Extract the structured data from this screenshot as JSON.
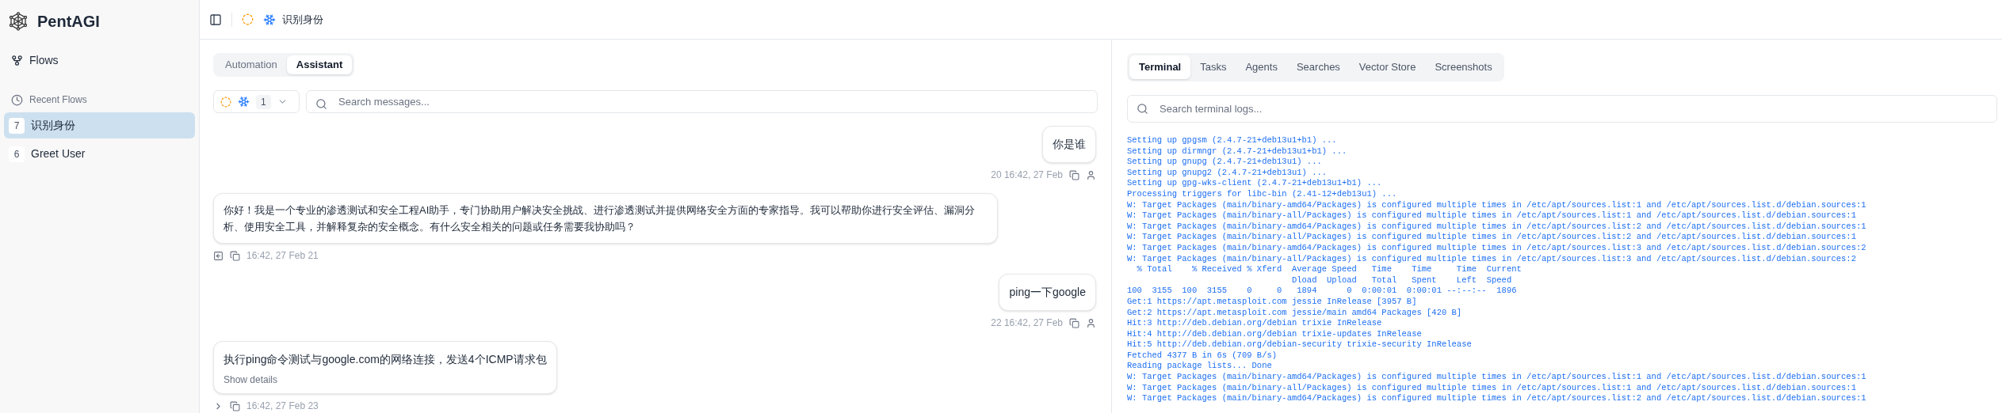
{
  "sidebar": {
    "brand": "PentAGI",
    "nav": [
      {
        "label": "Flows"
      }
    ],
    "section_title": "Recent Flows",
    "flows": [
      {
        "number": "7",
        "title": "识别身份",
        "selected": true
      },
      {
        "number": "6",
        "title": "Greet User",
        "selected": false
      }
    ]
  },
  "header": {
    "flow_title": "识别身份"
  },
  "chat": {
    "tabs": [
      {
        "label": "Automation",
        "selected": false
      },
      {
        "label": "Assistant",
        "selected": true
      }
    ],
    "filter": {
      "count": "1"
    },
    "search": {
      "placeholder": "Search messages..."
    },
    "messages": [
      {
        "kind": "user",
        "text": "你是谁",
        "meta": "20 16:42, 27 Feb"
      },
      {
        "kind": "assistant",
        "text": "你好！我是一个专业的渗透测试和安全工程AI助手，专门协助用户解决安全挑战、进行渗透测试并提供网络安全方面的专家指导。我可以帮助你进行安全评估、漏洞分析、使用安全工具，并解释复杂的安全概念。有什么安全相关的问题或任务需要我协助吗？",
        "meta": "16:42, 27 Feb 21"
      },
      {
        "kind": "user",
        "text": "ping一下google",
        "meta": "22 16:42, 27 Feb"
      },
      {
        "kind": "task",
        "text": "执行ping命令测试与google.com的网络连接，发送4个ICMP请求包",
        "details": "Show details",
        "meta": "16:42, 27 Feb 23"
      }
    ]
  },
  "terminal": {
    "tabs": [
      {
        "label": "Terminal",
        "selected": true
      },
      {
        "label": "Tasks",
        "selected": false
      },
      {
        "label": "Agents",
        "selected": false
      },
      {
        "label": "Searches",
        "selected": false
      },
      {
        "label": "Vector Store",
        "selected": false
      },
      {
        "label": "Screenshots",
        "selected": false
      }
    ],
    "search": {
      "placeholder": "Search terminal logs..."
    },
    "lines": [
      "Setting up gpgsm (2.4.7-21+deb13u1+b1) ...",
      "Setting up dirmngr (2.4.7-21+deb13u1+b1) ...",
      "Setting up gnupg (2.4.7-21+deb13u1) ...",
      "Setting up gnupg2 (2.4.7-21+deb13u1) ...",
      "Setting up gpg-wks-client (2.4.7-21+deb13u1+b1) ...",
      "Processing triggers for libc-bin (2.41-12+deb13u1) ...",
      "W: Target Packages (main/binary-amd64/Packages) is configured multiple times in /etc/apt/sources.list:1 and /etc/apt/sources.list.d/debian.sources:1",
      "W: Target Packages (main/binary-all/Packages) is configured multiple times in /etc/apt/sources.list:1 and /etc/apt/sources.list.d/debian.sources:1",
      "W: Target Packages (main/binary-amd64/Packages) is configured multiple times in /etc/apt/sources.list:2 and /etc/apt/sources.list.d/debian.sources:1",
      "W: Target Packages (main/binary-all/Packages) is configured multiple times in /etc/apt/sources.list:2 and /etc/apt/sources.list.d/debian.sources:1",
      "W: Target Packages (main/binary-amd64/Packages) is configured multiple times in /etc/apt/sources.list:3 and /etc/apt/sources.list.d/debian.sources:2",
      "W: Target Packages (main/binary-all/Packages) is configured multiple times in /etc/apt/sources.list:3 and /etc/apt/sources.list.d/debian.sources:2",
      "  % Total    % Received % Xferd  Average Speed   Time    Time     Time  Current",
      "                                 Dload  Upload   Total   Spent    Left  Speed",
      "100  3155  100  3155    0     0   1894      0  0:00:01  0:00:01 --:--:--  1896",
      "Get:1 https://apt.metasploit.com jessie InRelease [3957 B]",
      "Get:2 https://apt.metasploit.com jessie/main amd64 Packages [420 B]",
      "Hit:3 http://deb.debian.org/debian trixie InRelease",
      "Hit:4 http://deb.debian.org/debian trixie-updates InRelease",
      "Hit:5 http://deb.debian.org/debian-security trixie-security InRelease",
      "Fetched 4377 B in 6s (709 B/s)",
      "Reading package lists... Done",
      "W: Target Packages (main/binary-amd64/Packages) is configured multiple times in /etc/apt/sources.list:1 and /etc/apt/sources.list.d/debian.sources:1",
      "W: Target Packages (main/binary-all/Packages) is configured multiple times in /etc/apt/sources.list:1 and /etc/apt/sources.list.d/debian.sources:1",
      "W: Target Packages (main/binary-amd64/Packages) is configured multiple times in /etc/apt/sources.list:2 and /etc/apt/sources.list.d/debian.sources:1"
    ]
  }
}
